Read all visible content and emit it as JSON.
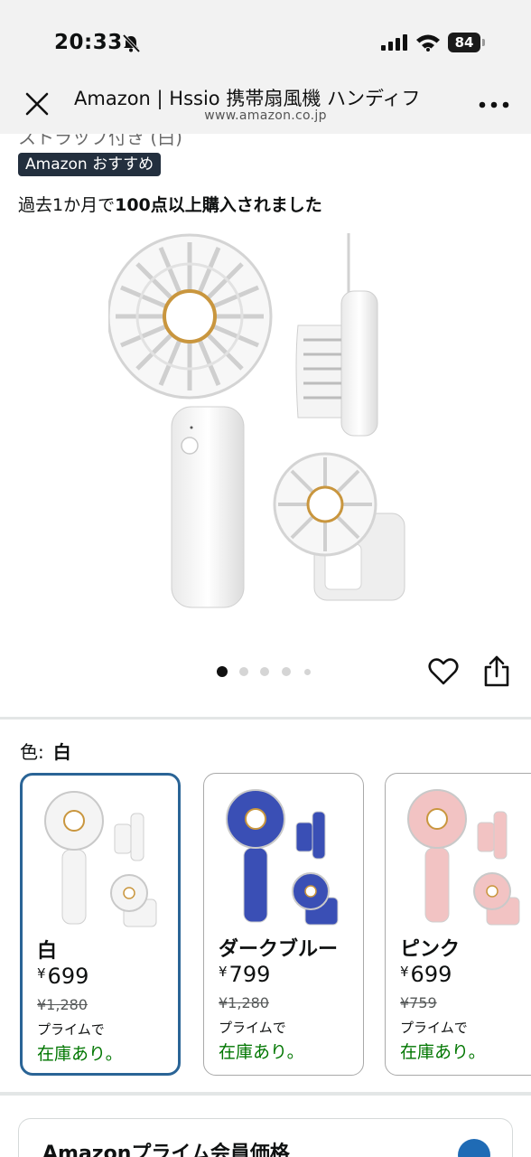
{
  "status_bar": {
    "time": "20:33",
    "battery": "84"
  },
  "browser": {
    "title": "Amazon | Hssio 携帯扇風機 ハンディフ",
    "url": "www.amazon.co.jp"
  },
  "product": {
    "cut_text": "ストラップ付き (白)",
    "badge": "Amazon おすすめ",
    "bought_prefix": "過去1か月で",
    "bought_bold": "100点以上購入されました"
  },
  "gallery": {
    "dots": 5,
    "active_index": 0
  },
  "color_selector": {
    "label": "色:",
    "selected": "白",
    "options": [
      {
        "name": "白",
        "currency": "¥",
        "price": "699",
        "old_price": "¥1,280",
        "prime": "プライムで",
        "stock": "在庫あり。",
        "color": "#f4f4f4"
      },
      {
        "name": "ダークブルー",
        "currency": "¥",
        "price": "799",
        "old_price": "¥1,280",
        "prime": "プライムで",
        "stock": "在庫あり。",
        "color": "#3a4fb5"
      },
      {
        "name": "ピンク",
        "currency": "¥",
        "price": "699",
        "old_price": "¥759",
        "prime": "プライムで",
        "stock": "在庫あり。",
        "color": "#f2c3c3"
      }
    ]
  },
  "prime_card": {
    "title": "Amazonプライム会員価格"
  }
}
